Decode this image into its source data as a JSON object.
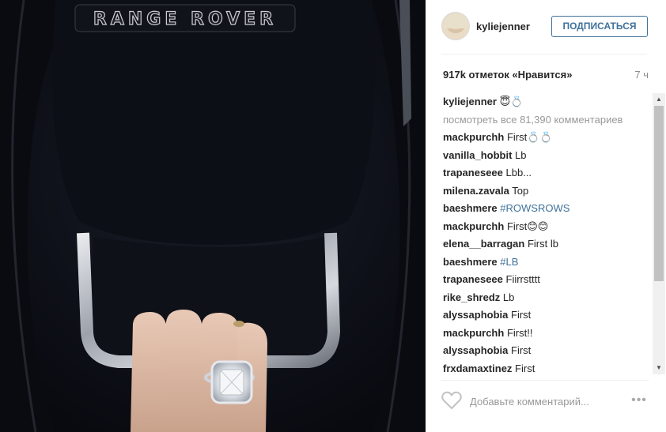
{
  "photo": {
    "brand_text": "RANGE ROVER",
    "description_alt": ""
  },
  "header": {
    "username": "kyliejenner",
    "follow_label": "ПОДПИСАТЬСЯ"
  },
  "stats": {
    "likes": "917k отметок «Нравится»",
    "time": "7 ч"
  },
  "comments": {
    "caption_user": "kyliejenner",
    "caption_text": "😇💍",
    "view_all": "посмотреть все 81,390 комментариев",
    "items": [
      {
        "user": "mackpurchh",
        "text": "First💍💍"
      },
      {
        "user": "vanilla_hobbit",
        "text": "Lb"
      },
      {
        "user": "trapaneseee",
        "text": "Lbb..."
      },
      {
        "user": "milena.zavala",
        "text": "Top"
      },
      {
        "user": "baeshmere",
        "text": "#ROWSROWS"
      },
      {
        "user": "mackpurchh",
        "text": "First😊😊"
      },
      {
        "user": "elena__barragan",
        "text": "First lb"
      },
      {
        "user": "baeshmere",
        "text": "#LB"
      },
      {
        "user": "trapaneseee",
        "text": "Fiirrstttt"
      },
      {
        "user": "rike_shredz",
        "text": "Lb"
      },
      {
        "user": "alyssaphobia",
        "text": "First"
      },
      {
        "user": "mackpurchh",
        "text": "First!!"
      },
      {
        "user": "alyssaphobia",
        "text": "First"
      },
      {
        "user": "frxdamaxtinez",
        "text": "First"
      }
    ]
  },
  "footer": {
    "comment_placeholder": "Добавьте комментарий...",
    "more_label": "•••"
  },
  "colors": {
    "link_blue": "#3f729b",
    "text_dark": "#262626",
    "text_muted": "#999999"
  }
}
